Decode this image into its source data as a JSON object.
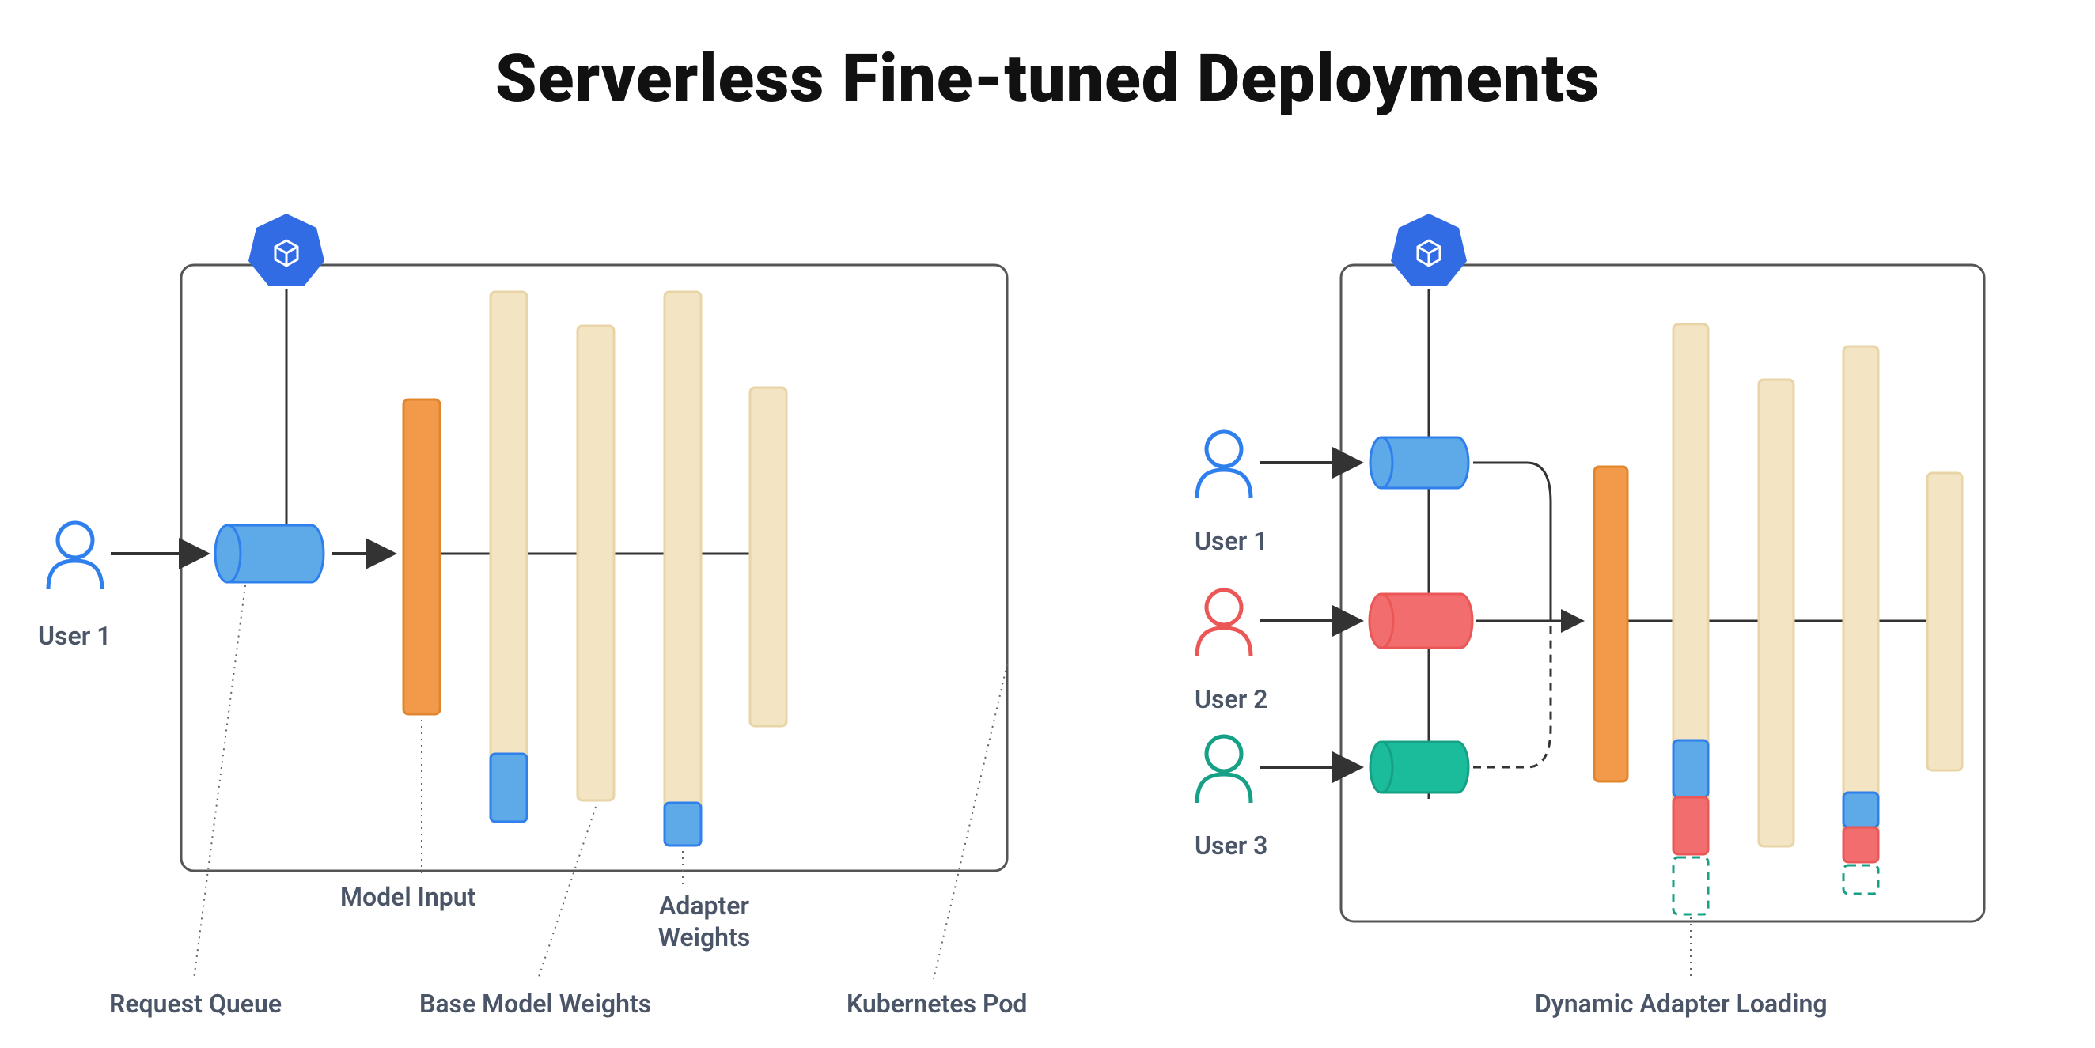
{
  "title": "Serverless Fine-tuned Deployments",
  "left": {
    "user1": "User 1",
    "request_queue": "Request Queue",
    "model_input": "Model Input",
    "base_model_weights": "Base Model Weights",
    "adapter_weights": "Adapter Weights",
    "kubernetes_pod": "Kubernetes Pod"
  },
  "right": {
    "user1": "User 1",
    "user2": "User 2",
    "user3": "User 3",
    "dynamic_adapter_loading": "Dynamic Adapter Loading"
  },
  "colors": {
    "beige": "#f3e5c3",
    "beige_stroke": "#e8d4a6",
    "orange": "#f2994a",
    "orange_stroke": "#e0862f",
    "blue": "#5ea9e8",
    "blue_stroke": "#2f80ed",
    "red": "#f26d6d",
    "red_stroke": "#eb5757",
    "green": "#1abc9c",
    "green_stroke": "#16a085",
    "k8s": "#326ce5",
    "box": "#555",
    "text": "#4a5568"
  },
  "diagram_notes": {
    "left_panel": "Single user → request queue (blue cylinder) → model input (orange bar) → base model weights (beige bars) with fixed blue adapter weights at bottom, inside one Kubernetes pod.",
    "right_panel": "Three users each with own colored queue (blue/red/green) → single model input → base model weights with stacked blue+red adapters and dashed green adapter slot (dynamic adapter loading), inside one Kubernetes pod."
  }
}
